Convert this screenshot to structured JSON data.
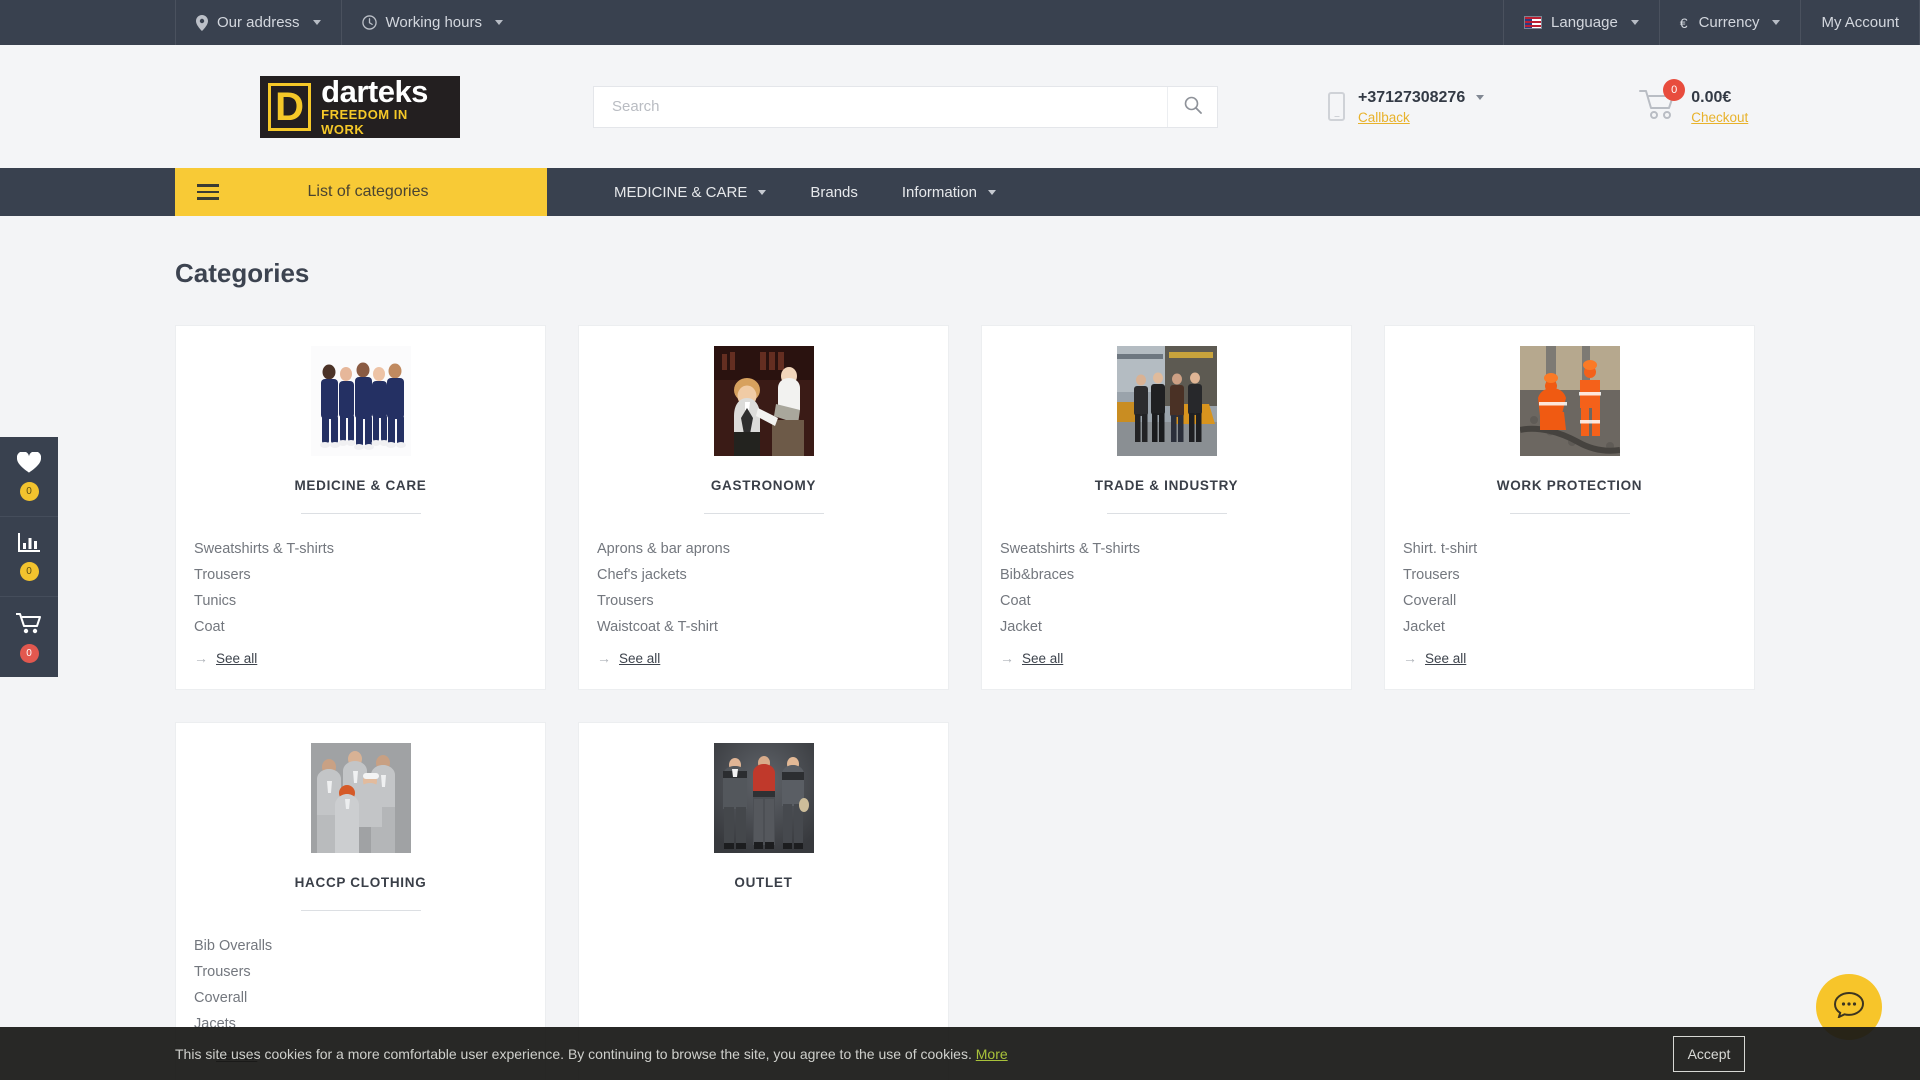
{
  "topbar": {
    "left_items": [
      {
        "label": "Our address",
        "icon": "location-pin-icon",
        "has_caret": true
      },
      {
        "label": "Working hours",
        "icon": "clock-icon",
        "has_caret": true
      }
    ],
    "right_items": [
      {
        "label": "Language",
        "icon": "flag-uk-icon",
        "has_caret": true
      },
      {
        "label": "Currency",
        "icon": "euro-icon",
        "symbol": "€",
        "has_caret": true
      },
      {
        "label": "My Account",
        "icon": "",
        "has_caret": false
      }
    ]
  },
  "header": {
    "logo": {
      "mark": "D",
      "name": "darteks",
      "tagline": "FREEDOM IN WORK"
    },
    "search": {
      "value": "",
      "placeholder": "Search",
      "button_icon": "search-icon"
    },
    "phone": {
      "number": "+37127308276",
      "callback_label": "Callback",
      "icon": "mobile-phone-icon"
    },
    "cart": {
      "count": "0",
      "total": "0.00€",
      "checkout_label": "Checkout",
      "icon": "shopping-cart-icon"
    }
  },
  "nav": {
    "categories_toggle": {
      "label": "List of categories",
      "icon": "hamburger-menu-icon"
    },
    "items": [
      {
        "label": "MEDICINE & CARE",
        "has_caret": true
      },
      {
        "label": "Brands",
        "has_caret": false
      },
      {
        "label": "Information",
        "has_caret": true
      }
    ]
  },
  "side_panel": {
    "items": [
      {
        "icon": "heart-icon",
        "badge": "0",
        "badge_color": "#f3c32e",
        "name": "wishlist"
      },
      {
        "icon": "bar-chart-icon",
        "badge": "0",
        "badge_color": "#f3c32e",
        "name": "compare"
      },
      {
        "icon": "shopping-cart-icon",
        "badge": "0",
        "badge_color": "#e2584f",
        "name": "cart"
      }
    ]
  },
  "main": {
    "title": "Categories",
    "see_all_label": "See all",
    "cards": [
      {
        "title": "MEDICINE & CARE",
        "image_alt": "medical-staff-in-navy-scrubs-photo",
        "subitems": [
          "Sweatshirts & T-shirts",
          "Trousers",
          "Tunics",
          "Coat"
        ]
      },
      {
        "title": "GASTRONOMY",
        "image_alt": "bartender-and-waiter-photo",
        "subitems": [
          "Aprons & bar aprons",
          "Chef's jackets",
          "Trousers",
          "Waistcoat & T-shirt"
        ]
      },
      {
        "title": "TRADE & INDUSTRY",
        "image_alt": "four-industrial-workers-photo",
        "subitems": [
          "Sweatshirts & T-shirts",
          "Bib&braces",
          "Coat",
          "Jacket"
        ]
      },
      {
        "title": "WORK PROTECTION",
        "image_alt": "two-railway-workers-in-orange-hi-vis-photo",
        "subitems": [
          "Shirt. t-shirt",
          "Trousers",
          "Coverall",
          "Jacket"
        ]
      },
      {
        "title": "HACCP CLOTHING",
        "image_alt": "group-in-light-grey-uniforms-photo",
        "subitems": [
          "Bib Overalls",
          "Trousers",
          "Coverall",
          "Jacets"
        ]
      },
      {
        "title": "OUTLET",
        "image_alt": "three-men-in-grey-and-red-workwear-photo",
        "subitems": []
      }
    ]
  },
  "chat": {
    "icon": "chat-bubble-icon"
  },
  "cookie": {
    "text": "This site uses cookies for a more comfortable user experience. By continuing to browse the site, you agree to the use of cookies.",
    "more_label": "More",
    "accept_label": "Accept"
  },
  "colors": {
    "dark": "#39414f",
    "yellow": "#f8ca36",
    "accent_link": "#e8b22b",
    "badge_red": "#e2584f",
    "cookie_link": "#a9c23a"
  }
}
